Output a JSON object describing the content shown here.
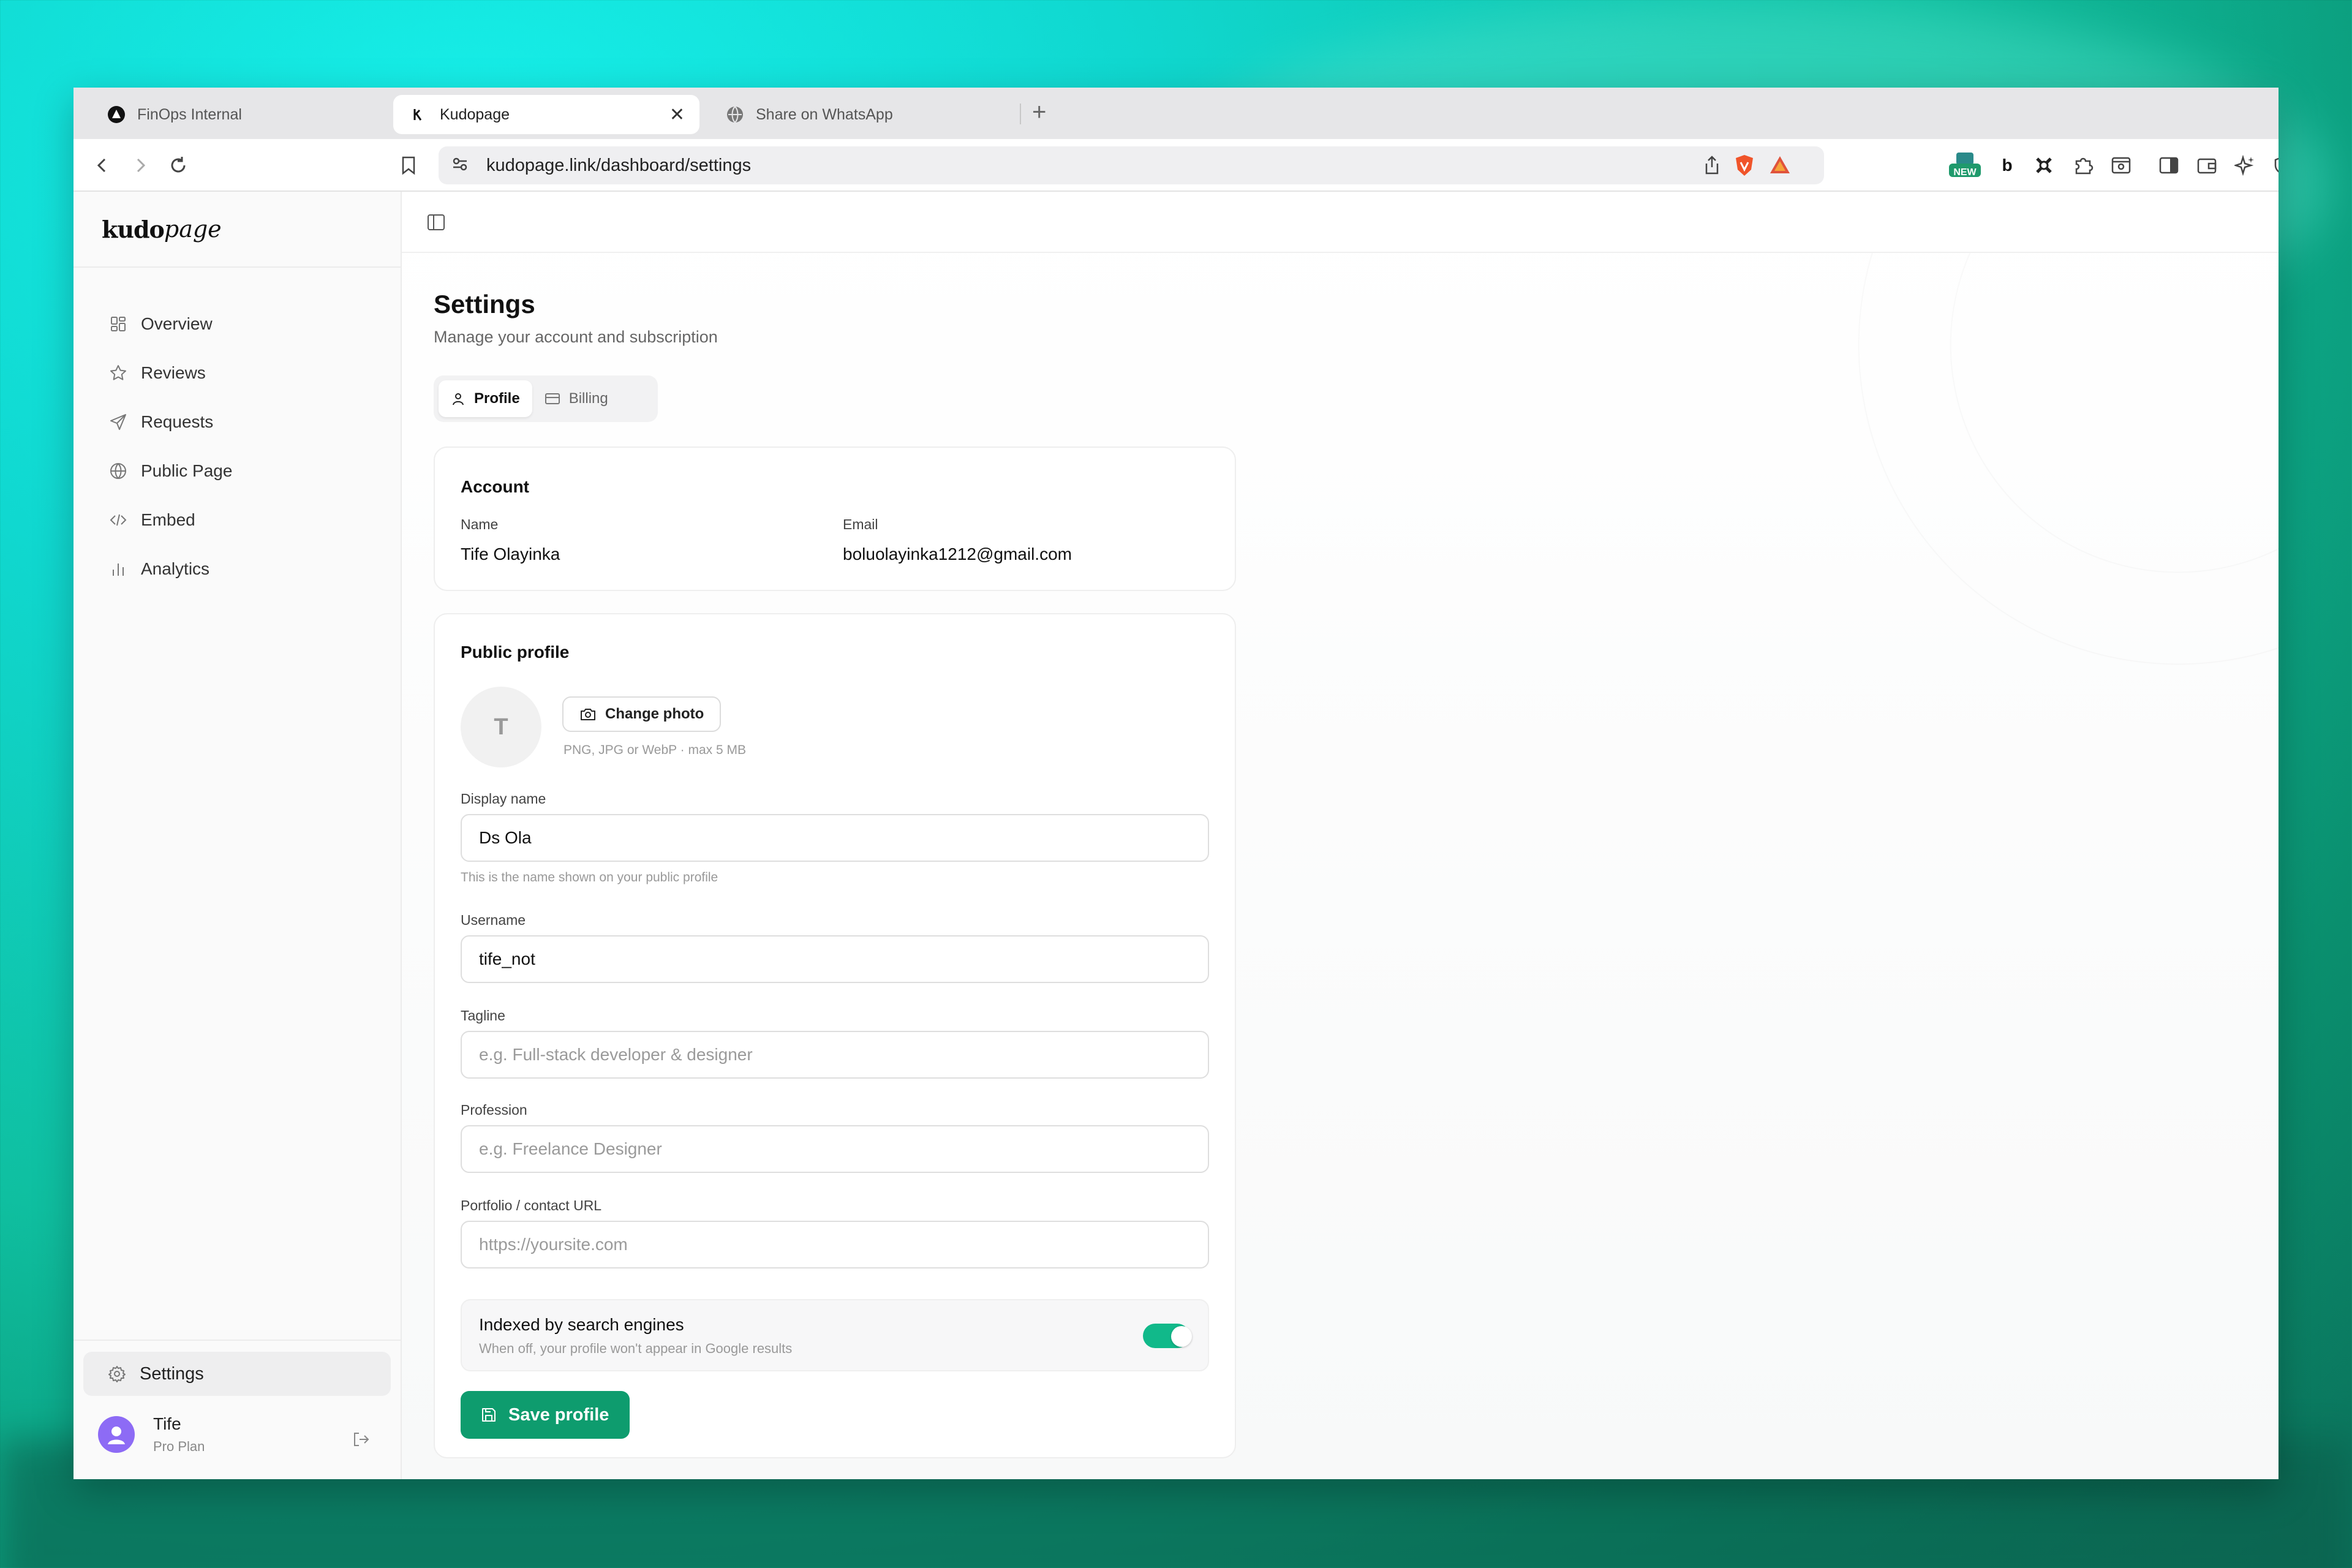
{
  "browser": {
    "tabs": [
      {
        "label": "FinOps Internal"
      },
      {
        "label": "Kudopage"
      },
      {
        "label": "Share on WhatsApp"
      }
    ],
    "url": "kudopage.link/dashboard/settings",
    "ext_new_badge": "NEW",
    "ext_b": "b"
  },
  "sidebar": {
    "logo_bold": "kudo",
    "logo_italic": "page",
    "items": [
      {
        "label": "Overview",
        "icon": "grid-icon"
      },
      {
        "label": "Reviews",
        "icon": "star-icon"
      },
      {
        "label": "Requests",
        "icon": "send-icon"
      },
      {
        "label": "Public Page",
        "icon": "globe-icon"
      },
      {
        "label": "Embed",
        "icon": "code-icon"
      },
      {
        "label": "Analytics",
        "icon": "bar-chart-icon"
      }
    ],
    "settings_label": "Settings",
    "user": {
      "name": "Tife",
      "plan": "Pro Plan"
    }
  },
  "page": {
    "title": "Settings",
    "subtitle": "Manage your account and subscription",
    "tabs": [
      {
        "label": "Profile"
      },
      {
        "label": "Billing"
      }
    ]
  },
  "account": {
    "title": "Account",
    "name_label": "Name",
    "name_value": "Tife Olayinka",
    "email_label": "Email",
    "email_value": "boluolayinka1212@gmail.com"
  },
  "public_profile": {
    "title": "Public profile",
    "avatar_letter": "T",
    "change_photo": "Change photo",
    "photo_hint": "PNG, JPG or WebP · max 5 MB",
    "display_name_label": "Display name",
    "display_name_value": "Ds Ola",
    "display_name_hint": "This is the name shown on your public profile",
    "username_label": "Username",
    "username_value": "tife_not",
    "tagline_label": "Tagline",
    "tagline_placeholder": "e.g. Full-stack developer & designer",
    "profession_label": "Profession",
    "profession_placeholder": "e.g. Freelance Designer",
    "portfolio_label": "Portfolio / contact URL",
    "portfolio_placeholder": "https://yoursite.com",
    "indexed_title": "Indexed by search engines",
    "indexed_desc": "When off, your profile won't appear in Google results",
    "indexed_on": true,
    "save_label": "Save profile",
    "accent": "#0e9c6e",
    "toggle_color": "#11b98a"
  }
}
